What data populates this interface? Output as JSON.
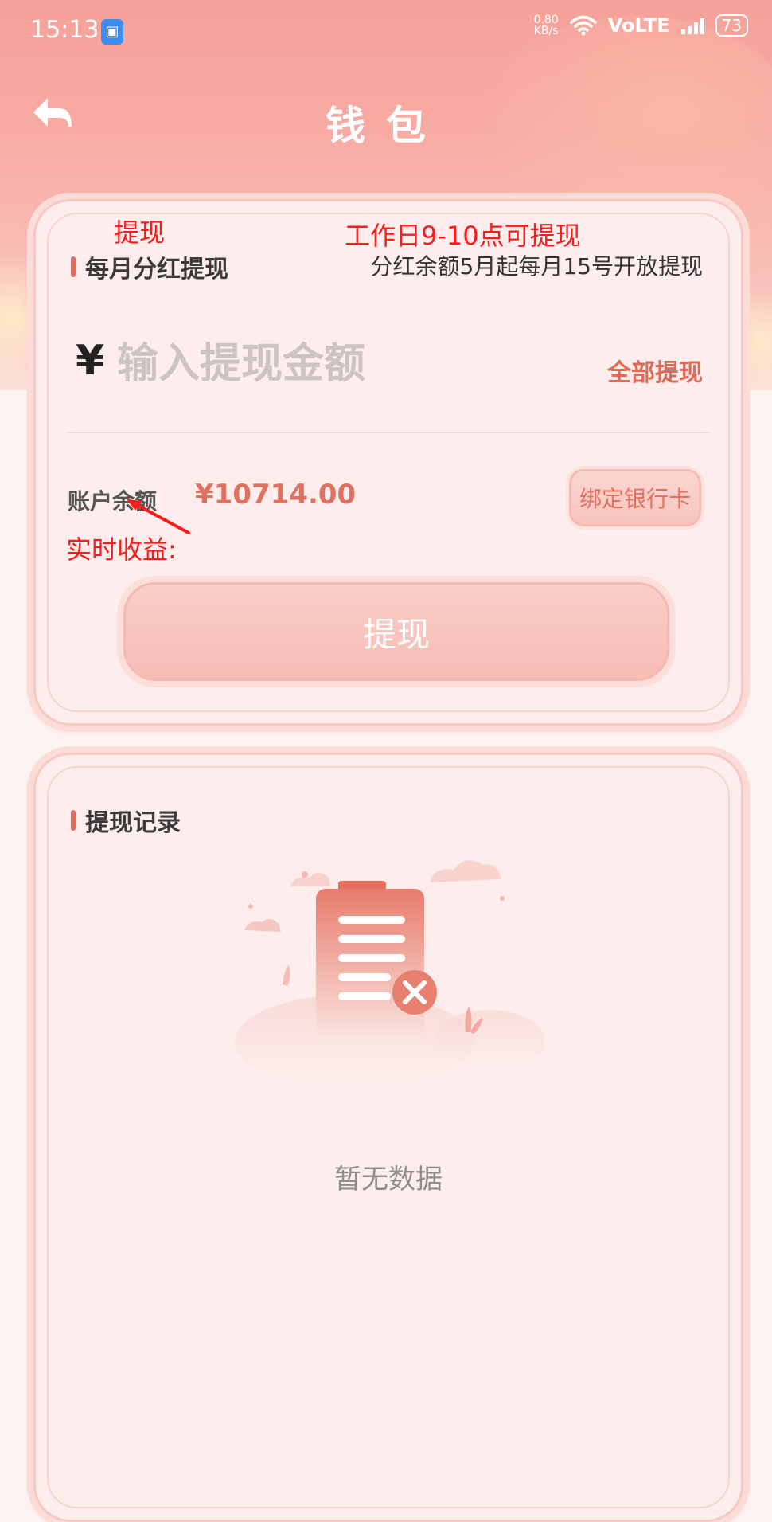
{
  "status_bar": {
    "time": "15:13",
    "net_speed_value": "0.80",
    "net_speed_unit": "KB/s",
    "network_type": "VoLTE",
    "battery": "73"
  },
  "nav": {
    "title": "钱包"
  },
  "withdraw_card": {
    "section_title": "每月分红提现",
    "notice": "分红余额5月起每月15号开放提现",
    "currency_symbol": "¥",
    "amount_placeholder": "输入提现金额",
    "withdraw_all_label": "全部提现",
    "balance_label": "账户余额",
    "balance_value": "¥10714.00",
    "bind_card_label": "绑定银行卡",
    "withdraw_button_label": "提现"
  },
  "annotations": {
    "withdraw_note": "提现",
    "workday_note": "工作日9-10点可提现",
    "realtime_note": "实时收益:"
  },
  "records_card": {
    "section_title": "提现记录",
    "empty_text": "暂无数据"
  },
  "colors": {
    "accent": "#e06a55",
    "header_bg": "#f6a19a",
    "annotation": "#ff1a1a"
  }
}
